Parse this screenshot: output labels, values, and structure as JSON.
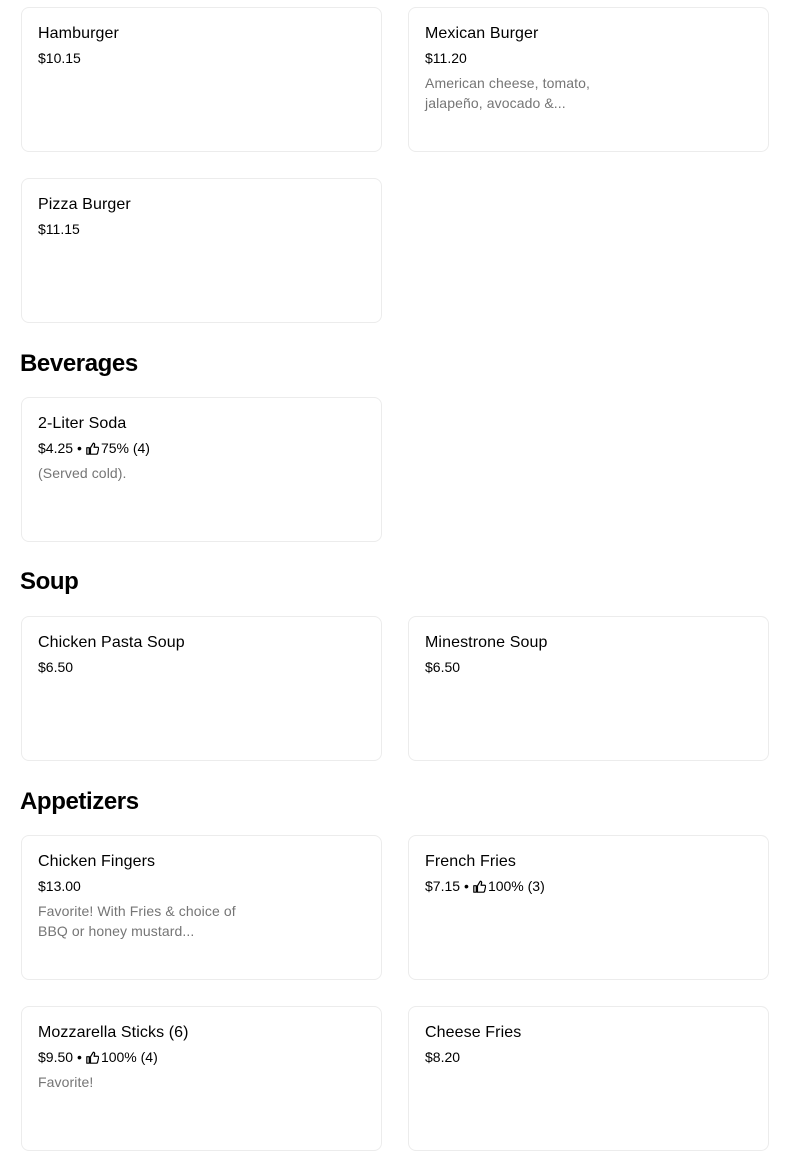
{
  "sections": {
    "beverages": "Beverages",
    "soup": "Soup",
    "appetizers": "Appetizers"
  },
  "items": {
    "hamburger": {
      "name": "Hamburger",
      "price": "$10.15"
    },
    "mexican_burger": {
      "name": "Mexican Burger",
      "price": "$11.20",
      "description": "American cheese, tomato, jalapeño, avocado &..."
    },
    "pizza_burger": {
      "name": "Pizza Burger",
      "price": "$11.15"
    },
    "soda": {
      "name": "2-Liter Soda",
      "price": "$4.25",
      "rating": "75% (4)",
      "description": "(Served cold)."
    },
    "chicken_pasta_soup": {
      "name": "Chicken Pasta Soup",
      "price": "$6.50"
    },
    "minestrone_soup": {
      "name": "Minestrone Soup",
      "price": "$6.50"
    },
    "chicken_fingers": {
      "name": "Chicken Fingers",
      "price": "$13.00",
      "description": "Favorite! With Fries & choice of BBQ or honey mustard..."
    },
    "french_fries": {
      "name": "French Fries",
      "price": "$7.15",
      "rating": "100% (3)"
    },
    "mozzarella_sticks": {
      "name": "Mozzarella Sticks (6)",
      "price": "$9.50",
      "rating": "100% (4)",
      "description": "Favorite!"
    },
    "cheese_fries": {
      "name": "Cheese Fries",
      "price": "$8.20"
    }
  },
  "meta_separator": "•",
  "icons": {
    "rating": "thumbs-up-icon"
  },
  "colors": {
    "text": "#000000",
    "description": "#757575",
    "card_border": "#ececec"
  }
}
